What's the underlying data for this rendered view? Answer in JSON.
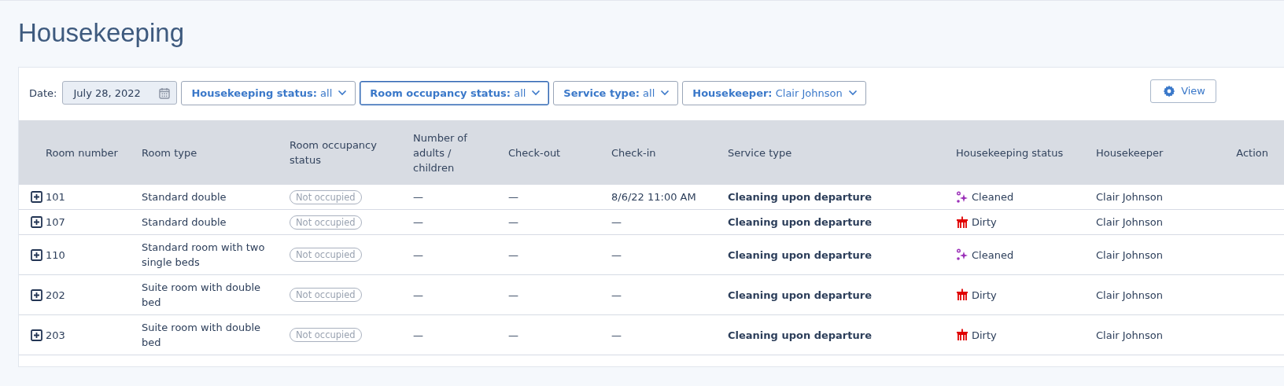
{
  "page": {
    "title": "Housekeeping"
  },
  "filters": {
    "date_label": "Date:",
    "date_value": "July 28, 2022",
    "dropdowns": [
      {
        "label": "Housekeeping status:",
        "value": "all",
        "selected": false
      },
      {
        "label": "Room occupancy status:",
        "value": "all",
        "selected": true
      },
      {
        "label": "Service type:",
        "value": "all",
        "selected": false
      },
      {
        "label": "Housekeeper:",
        "value": "Clair Johnson",
        "selected": false
      }
    ],
    "view_button": "View"
  },
  "table": {
    "columns": [
      "Room number",
      "Room type",
      "Room occupancy status",
      "Number of adults / children",
      "Check-out",
      "Check-in",
      "Service type",
      "Housekeeping status",
      "Housekeeper",
      "Action"
    ],
    "rows": [
      {
        "room": "101",
        "type": "Standard double",
        "occupancy": "Not occupied",
        "guests": "—",
        "checkout": "—",
        "checkin": "8/6/22 11:00 AM",
        "service": "Cleaning upon departure",
        "status": {
          "kind": "cleaned",
          "text": "Cleaned"
        },
        "housekeeper": "Clair Johnson"
      },
      {
        "room": "107",
        "type": "Standard double",
        "occupancy": "Not occupied",
        "guests": "—",
        "checkout": "—",
        "checkin": "—",
        "service": "Cleaning upon departure",
        "status": {
          "kind": "dirty",
          "text": "Dirty"
        },
        "housekeeper": "Clair Johnson"
      },
      {
        "room": "110",
        "type": "Standard room with two single beds",
        "occupancy": "Not occupied",
        "guests": "—",
        "checkout": "—",
        "checkin": "—",
        "service": "Cleaning upon departure",
        "status": {
          "kind": "cleaned",
          "text": "Cleaned"
        },
        "housekeeper": "Clair Johnson"
      },
      {
        "room": "202",
        "type": "Suite room with double bed",
        "occupancy": "Not occupied",
        "guests": "—",
        "checkout": "—",
        "checkin": "—",
        "service": "Cleaning upon departure",
        "status": {
          "kind": "dirty",
          "text": "Dirty"
        },
        "housekeeper": "Clair Johnson"
      },
      {
        "room": "203",
        "type": "Suite room with double bed",
        "occupancy": "Not occupied",
        "guests": "—",
        "checkout": "—",
        "checkin": "—",
        "service": "Cleaning upon departure",
        "status": {
          "kind": "dirty",
          "text": "Dirty"
        },
        "housekeeper": "Clair Johnson"
      }
    ]
  }
}
